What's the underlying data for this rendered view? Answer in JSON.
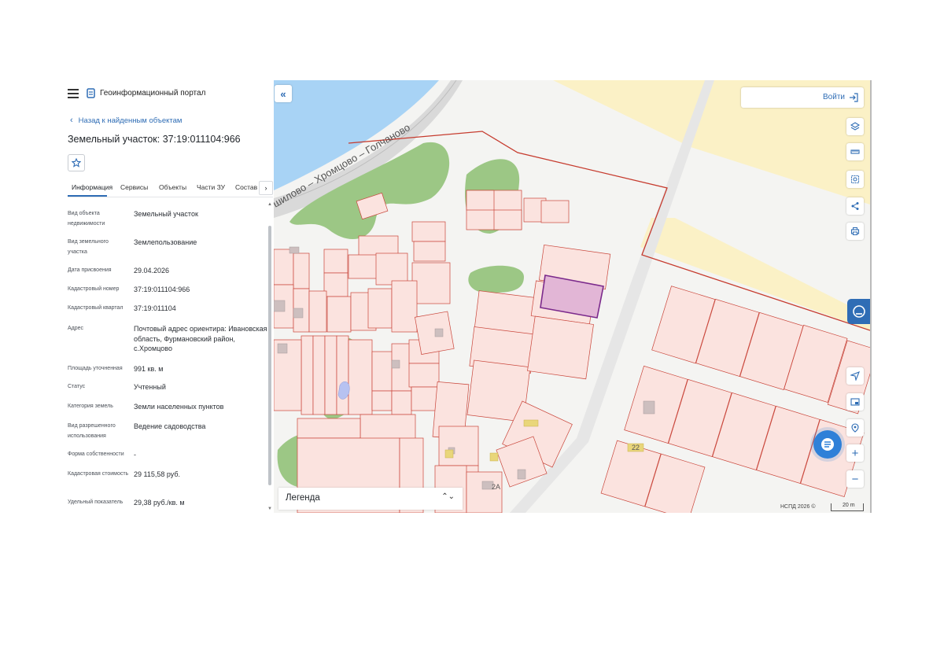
{
  "header": {
    "portal_title": "Геоинформационный портал"
  },
  "navigation": {
    "back_label": "Назад к найденным объектам"
  },
  "parcel": {
    "title": "Земельный участок: 37:19:011104:966"
  },
  "tabs": [
    {
      "label": "Информация"
    },
    {
      "label": "Сервисы"
    },
    {
      "label": "Объекты"
    },
    {
      "label": "Части ЗУ"
    },
    {
      "label": "Состав"
    }
  ],
  "properties": [
    {
      "label": "Вид объекта недвижимости",
      "value": "Земельный участок"
    },
    {
      "label": "Вид земельного участка",
      "value": "Землепользование"
    },
    {
      "label": "Дата присвоения",
      "value": "29.04.2026"
    },
    {
      "label": "Кадастровый номер",
      "value": "37:19:011104:966"
    },
    {
      "label": "Кадастровый квартал",
      "value": "37:19:011104"
    },
    {
      "label": "Адрес",
      "value": "Почтовый адрес ориентира: Ивановская область, Фурмановский район, с.Хромцово"
    },
    {
      "label": "Площадь уточненная",
      "value": "991 кв. м"
    },
    {
      "label": "Статус",
      "value": "Учтенный"
    },
    {
      "label": "Категория земель",
      "value": "Земли населенных пунктов"
    },
    {
      "label": "Вид разрешенного использования",
      "value": "Ведение садоводства"
    },
    {
      "label": "Форма собственности",
      "value": "-"
    },
    {
      "label": "Кадастровая стоимость",
      "value": "29 115,58 руб."
    },
    {
      "label": "Удельный показатель",
      "value": "29,38 руб./кв. м"
    }
  ],
  "map": {
    "road_label": "шилово – Хромцово – Голчаново",
    "login_label": "Войти",
    "legend_label": "Легенда",
    "attribution": "НСПД 2026 ©",
    "scale_label": "20 m",
    "house_numbers": [
      "22",
      "2А"
    ],
    "toolbar_icons": [
      "layers-icon",
      "ruler-icon",
      "select-area-icon",
      "share-icon",
      "print-icon",
      "locate-icon",
      "minimap-icon",
      "geo-search-icon",
      "zoom-in-icon",
      "zoom-out-icon"
    ]
  },
  "colors": {
    "accent": "#2f6db5",
    "parcel_fill": "#fbe3df",
    "parcel_border": "#c9453a",
    "selected_parcel_fill": "#e2b6d6",
    "selected_parcel_border": "#7b2a8c",
    "vegetation": "#9cc785",
    "water": "#a8d3f5",
    "zone_yellow": "#fbf1c6"
  }
}
